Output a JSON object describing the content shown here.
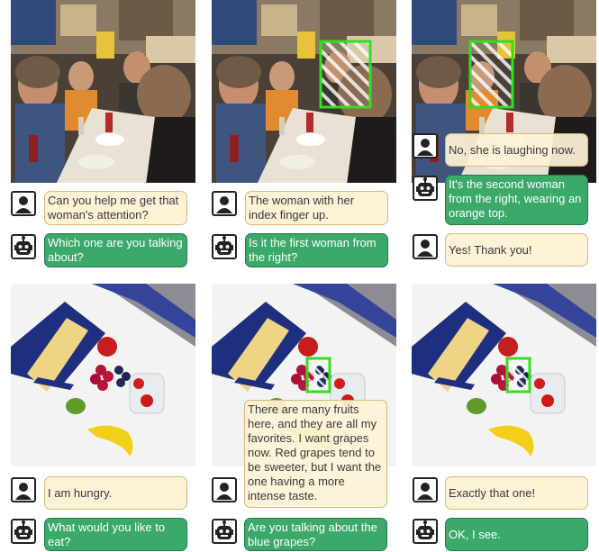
{
  "colors": {
    "user_bubble": "#fdf2d6",
    "user_border": "#d8b877",
    "bot_bubble": "#3aa96a",
    "bot_border": "#237a48",
    "highlight": "#33dd22"
  },
  "icons": {
    "user": "person-icon",
    "bot": "robot-icon"
  },
  "dialogues": [
    {
      "scene": "restaurant-scene",
      "panels": [
        {
          "messages": [
            {
              "speaker": "user",
              "text": "Can you help me get that woman's attention?"
            },
            {
              "speaker": "bot",
              "text": "Which one are you talking about?"
            }
          ]
        },
        {
          "messages": [
            {
              "speaker": "user",
              "text": "The woman with her index finger up."
            },
            {
              "speaker": "bot",
              "text": "Is it the first woman from the right?"
            }
          ]
        },
        {
          "messages": [
            {
              "speaker": "user",
              "text": "No, she is laughing now."
            },
            {
              "speaker": "bot",
              "text": "It's the second woman from the right, wearing an orange top."
            },
            {
              "speaker": "user",
              "text": "Yes! Thank you!"
            }
          ]
        }
      ]
    },
    {
      "scene": "fruit-scene",
      "panels": [
        {
          "messages": [
            {
              "speaker": "user",
              "text": "I am hungry."
            },
            {
              "speaker": "bot",
              "text": "What would you like to eat?"
            }
          ]
        },
        {
          "messages": [
            {
              "speaker": "user",
              "text": "There are many fruits here, and they are all my favorites. I want grapes now. Red grapes tend to be sweeter, but I want the one having a more intense taste."
            },
            {
              "speaker": "bot",
              "text": "Are you talking about the blue grapes?"
            }
          ]
        },
        {
          "messages": [
            {
              "speaker": "user",
              "text": "Exactly that one!"
            },
            {
              "speaker": "bot",
              "text": "OK, I see."
            }
          ]
        }
      ]
    }
  ]
}
